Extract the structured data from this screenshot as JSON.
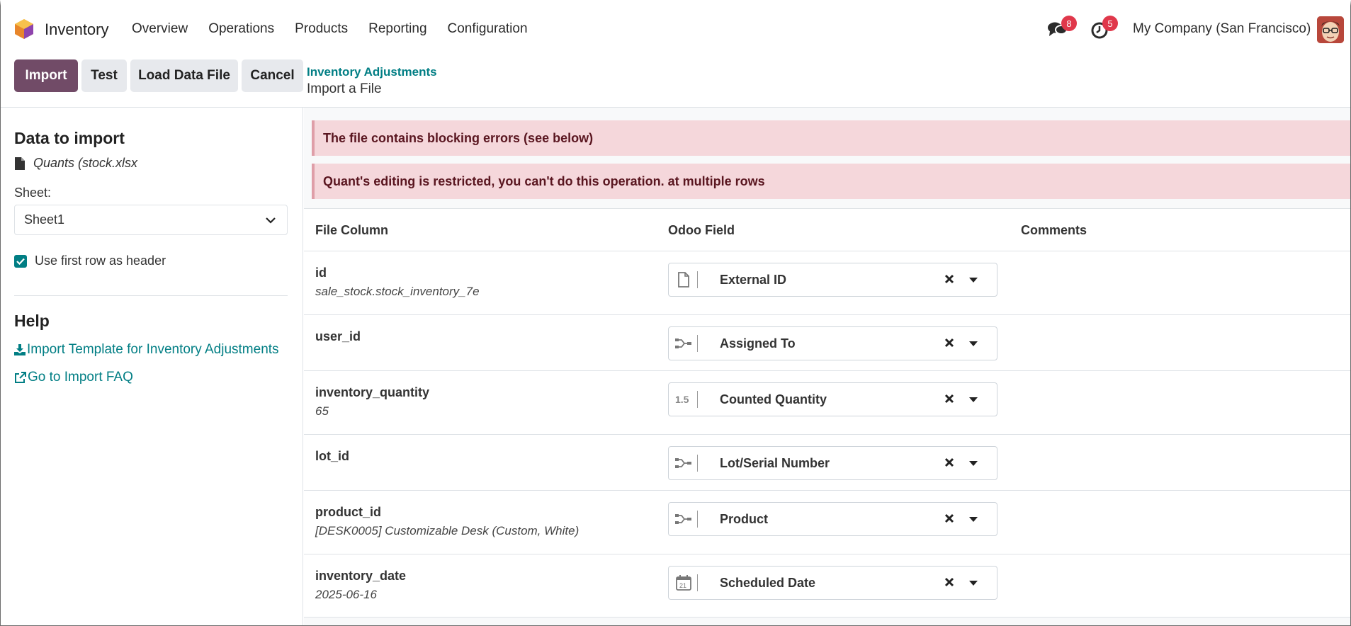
{
  "navbar": {
    "app_name": "Inventory",
    "menu": [
      "Overview",
      "Operations",
      "Products",
      "Reporting",
      "Configuration"
    ],
    "messages_count": "8",
    "activities_count": "5",
    "company": "My Company (San Francisco)"
  },
  "control_panel": {
    "import_label": "Import",
    "test_label": "Test",
    "load_label": "Load Data File",
    "cancel_label": "Cancel",
    "breadcrumb_parent": "Inventory Adjustments",
    "breadcrumb_current": "Import a File"
  },
  "sidebar": {
    "data_title": "Data to import",
    "file_name": "Quants (stock.xlsx",
    "sheet_label": "Sheet:",
    "sheet_value": "Sheet1",
    "header_checkbox_label": "Use first row as header",
    "header_checkbox_checked": true,
    "help_title": "Help",
    "template_link": "Import Template for Inventory Adjustments",
    "faq_link": "Go to Import FAQ"
  },
  "alerts": [
    "The file contains blocking errors (see below)",
    "Quant's editing is restricted, you can't do this operation. at multiple rows"
  ],
  "table": {
    "headers": [
      "File Column",
      "Odoo Field",
      "Comments"
    ],
    "rows": [
      {
        "column": "id",
        "sample": "sale_stock.stock_inventory_7e",
        "field": "External ID",
        "icon": "file-icon"
      },
      {
        "column": "user_id",
        "sample": "",
        "field": "Assigned To",
        "icon": "relation-icon"
      },
      {
        "column": "inventory_quantity",
        "sample": "65",
        "field": "Counted Quantity",
        "icon": "decimal-icon"
      },
      {
        "column": "lot_id",
        "sample": "",
        "field": "Lot/Serial Number",
        "icon": "relation-icon"
      },
      {
        "column": "product_id",
        "sample": "[DESK0005] Customizable Desk (Custom, White)",
        "field": "Product",
        "icon": "relation-icon"
      },
      {
        "column": "inventory_date",
        "sample": "2025-06-16",
        "field": "Scheduled Date",
        "icon": "calendar-icon"
      }
    ]
  },
  "colors": {
    "primary": "#714b67",
    "link": "#017e84",
    "alert_bg": "#f5d7db",
    "badge": "#e0384b"
  }
}
